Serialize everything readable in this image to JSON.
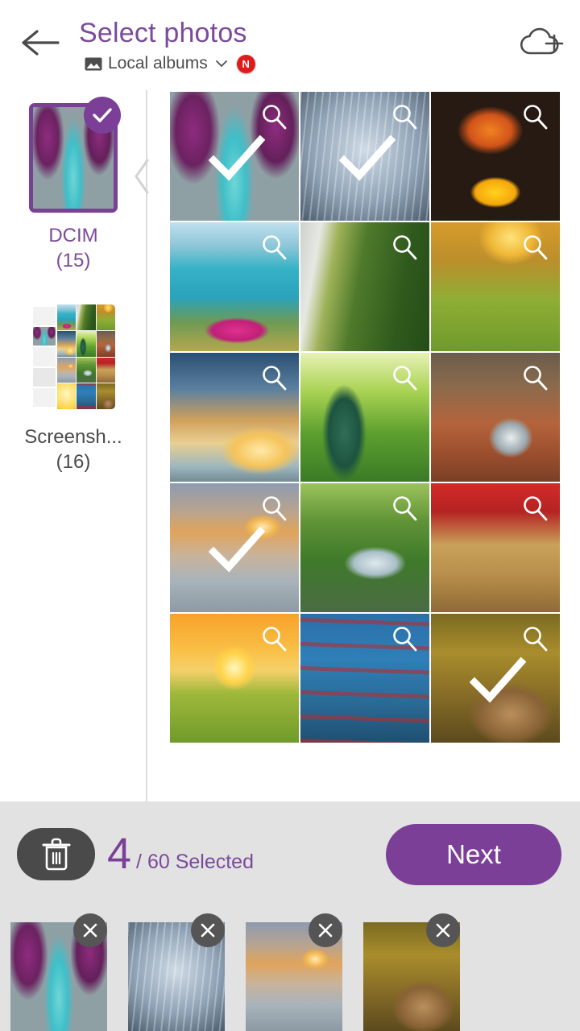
{
  "header": {
    "back_icon": "arrow-left-icon",
    "title": "Select photos",
    "album_source_icon": "image-icon",
    "album_source_label": "Local albums",
    "chevron_icon": "chevron-down-icon",
    "new_badge": "N",
    "cloud_add_icon": "cloud-add-icon"
  },
  "sidebar": {
    "albums": [
      {
        "name": "DCIM",
        "count": "(15)",
        "selected": true,
        "art": "p-canyon"
      },
      {
        "name": "Screensh...",
        "count": "(16)",
        "selected": false,
        "art": "p-screenshot"
      }
    ]
  },
  "grid": {
    "zoom_icon": "magnifier-icon",
    "check_icon": "check-icon",
    "photos": [
      {
        "id": "photo-1",
        "art": "p-canyon",
        "alt": "purple canyon river",
        "selected": true
      },
      {
        "id": "photo-2",
        "art": "p-winter",
        "alt": "snowy winter forest",
        "selected": true
      },
      {
        "id": "photo-3",
        "art": "p-butterfly",
        "alt": "butterfly on yellow flower",
        "selected": false
      },
      {
        "id": "photo-4",
        "art": "p-lake",
        "alt": "mountain lake with pink flowers",
        "selected": false
      },
      {
        "id": "photo-5",
        "art": "p-moss",
        "alt": "mossy waterfall wall",
        "selected": false
      },
      {
        "id": "photo-6",
        "art": "p-goldgrass",
        "alt": "golden sunset grass hills",
        "selected": false
      },
      {
        "id": "photo-7",
        "art": "p-sunrays",
        "alt": "sunrays over river",
        "selected": false
      },
      {
        "id": "photo-8",
        "art": "p-peacock",
        "alt": "tree canopy from below",
        "selected": false
      },
      {
        "id": "photo-9",
        "art": "p-autumncreek",
        "alt": "autumn rocky creek",
        "selected": false
      },
      {
        "id": "photo-10",
        "art": "p-pier",
        "alt": "pier at sunset with birds",
        "selected": true
      },
      {
        "id": "photo-11",
        "art": "p-forestcreek",
        "alt": "green forest stream",
        "selected": false
      },
      {
        "id": "photo-12",
        "art": "p-redbridge",
        "alt": "red autumn wooden bridge",
        "selected": false
      },
      {
        "id": "photo-13",
        "art": "p-poppy",
        "alt": "poppy field sunset",
        "selected": false
      },
      {
        "id": "photo-14",
        "art": "p-blueforest",
        "alt": "blue forest red leaves",
        "selected": false
      },
      {
        "id": "photo-15",
        "art": "p-autumnbench",
        "alt": "autumn boardwalk bench",
        "selected": true
      }
    ]
  },
  "bottom": {
    "trash_icon": "trash-icon",
    "count": "4",
    "count_total": "/ 60 Selected",
    "next_label": "Next",
    "remove_icon": "close-icon",
    "selected_thumbs": [
      {
        "id": "thumb-1",
        "art": "p-canyon",
        "alt": "purple canyon river"
      },
      {
        "id": "thumb-2",
        "art": "p-winter",
        "alt": "snowy winter forest"
      },
      {
        "id": "thumb-3",
        "art": "p-pier",
        "alt": "pier at sunset with birds"
      },
      {
        "id": "thumb-4",
        "art": "p-autumnbench",
        "alt": "autumn boardwalk bench"
      }
    ]
  },
  "colors": {
    "accent_purple": "#7b3f98",
    "title_purple": "#7b4a9c",
    "badge_red": "#e01b1b",
    "bottom_bar_gray": "#e2e2e2",
    "dark_gray": "#4a4a4a"
  }
}
